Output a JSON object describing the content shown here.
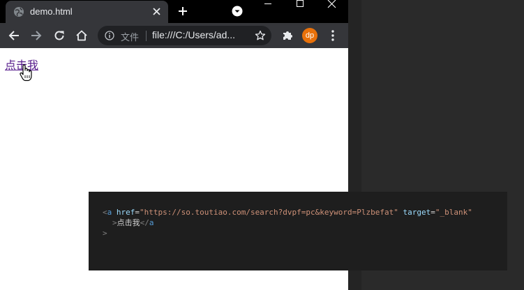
{
  "browser": {
    "tab": {
      "title": "demo.html"
    },
    "address_bar": {
      "scheme_label": "文件",
      "url": "file:///C:/Users/ad..."
    },
    "profile": {
      "initials": "dp",
      "color": "#e8710a"
    },
    "page": {
      "link_text": "点击我",
      "link_color": "#551a8b"
    }
  },
  "code_tooltip": {
    "open_bracket": "<",
    "tag_name": "a",
    "href_attr": "href",
    "equals": "=",
    "href_value": "\"https://so.toutiao.com/search?dvpf=pc&keyword=Plzbefat\"",
    "target_attr": "target",
    "target_value": "\"_blank\"",
    "close_open_bracket": ">",
    "inner_text": "点击我",
    "close_tag_start": "</",
    "close_tag_name": "a",
    "final_bracket": ">"
  },
  "icons": {
    "tab": "globe-icon",
    "tab_close": "close-icon",
    "new_tab": "plus-icon",
    "tab_search": "chevron-down-circle-icon",
    "window": [
      "minimize-icon",
      "maximize-icon",
      "close-window-icon"
    ],
    "nav": [
      "back-arrow-icon",
      "forward-arrow-icon",
      "reload-icon",
      "home-icon"
    ],
    "omnibox": [
      "info-icon",
      "star-icon"
    ],
    "extensions": "puzzle-icon",
    "menu": "kebab-menu-icon",
    "cursor": "hand-pointer-icon"
  }
}
